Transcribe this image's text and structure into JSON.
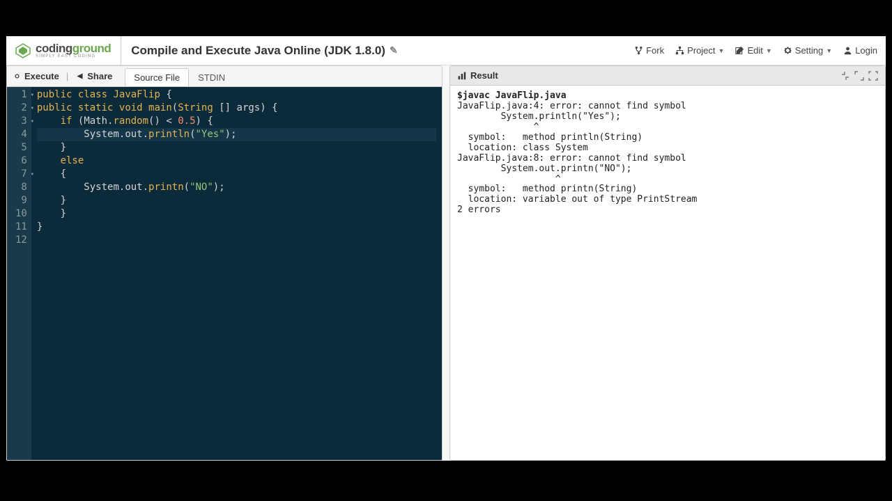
{
  "brand": {
    "name_a": "coding",
    "name_b": "ground",
    "tagline": "SIMPLY EASY CODING"
  },
  "page": {
    "title": "Compile and Execute Java Online (JDK 1.8.0)"
  },
  "menu": {
    "fork": "Fork",
    "project": "Project",
    "edit": "Edit",
    "setting": "Setting",
    "login": "Login"
  },
  "toolbar": {
    "execute": "Execute",
    "share": "Share"
  },
  "tabs": {
    "source": "Source File",
    "stdin": "STDIN"
  },
  "editor": {
    "lines": [
      {
        "n": 1,
        "fold": true,
        "tokens": [
          [
            "kw",
            "public"
          ],
          [
            "sp",
            " "
          ],
          [
            "kw",
            "class"
          ],
          [
            "sp",
            " "
          ],
          [
            "type",
            "JavaFlip"
          ],
          [
            "sp",
            " "
          ],
          [
            "punct",
            "{"
          ]
        ]
      },
      {
        "n": 2,
        "fold": true,
        "tokens": [
          [
            "kw",
            "public"
          ],
          [
            "sp",
            " "
          ],
          [
            "kw",
            "static"
          ],
          [
            "sp",
            " "
          ],
          [
            "kw",
            "void"
          ],
          [
            "sp",
            " "
          ],
          [
            "func",
            "main"
          ],
          [
            "punct",
            "("
          ],
          [
            "type",
            "String"
          ],
          [
            "sp",
            " "
          ],
          [
            "punct",
            "[] "
          ],
          [
            "ident",
            "args"
          ],
          [
            "punct",
            ")"
          ],
          [
            "sp",
            " "
          ],
          [
            "punct",
            "{"
          ]
        ]
      },
      {
        "n": 3,
        "fold": true,
        "tokens": [
          [
            "sp",
            "    "
          ],
          [
            "kw",
            "if"
          ],
          [
            "sp",
            " "
          ],
          [
            "punct",
            "("
          ],
          [
            "ident",
            "Math"
          ],
          [
            "punct",
            "."
          ],
          [
            "func",
            "random"
          ],
          [
            "punct",
            "()"
          ],
          [
            "sp",
            " "
          ],
          [
            "punct",
            "<"
          ],
          [
            "sp",
            " "
          ],
          [
            "num",
            "0.5"
          ],
          [
            "punct",
            ")"
          ],
          [
            "sp",
            " "
          ],
          [
            "punct",
            "{"
          ]
        ]
      },
      {
        "n": 4,
        "hl": true,
        "tokens": [
          [
            "sp",
            "        "
          ],
          [
            "ident",
            "System"
          ],
          [
            "punct",
            "."
          ],
          [
            "ident",
            "out"
          ],
          [
            "punct",
            "."
          ],
          [
            "func",
            "println"
          ],
          [
            "punct",
            "("
          ],
          [
            "str",
            "\"Yes\""
          ],
          [
            "punct",
            ");"
          ]
        ]
      },
      {
        "n": 5,
        "tokens": [
          [
            "sp",
            "    "
          ],
          [
            "punct",
            "}"
          ]
        ]
      },
      {
        "n": 6,
        "tokens": [
          [
            "sp",
            "    "
          ],
          [
            "kw",
            "else"
          ]
        ]
      },
      {
        "n": 7,
        "fold": true,
        "tokens": [
          [
            "sp",
            "    "
          ],
          [
            "punct",
            "{"
          ]
        ]
      },
      {
        "n": 8,
        "tokens": [
          [
            "sp",
            "        "
          ],
          [
            "ident",
            "System"
          ],
          [
            "punct",
            "."
          ],
          [
            "ident",
            "out"
          ],
          [
            "punct",
            "."
          ],
          [
            "func",
            "printn"
          ],
          [
            "punct",
            "("
          ],
          [
            "str",
            "\"NO\""
          ],
          [
            "punct",
            ");"
          ]
        ]
      },
      {
        "n": 9,
        "tokens": [
          [
            "sp",
            "    "
          ],
          [
            "punct",
            "}"
          ]
        ]
      },
      {
        "n": 10,
        "tokens": [
          [
            "sp",
            "    "
          ],
          [
            "punct",
            "}"
          ]
        ]
      },
      {
        "n": 11,
        "tokens": [
          [
            "punct",
            "}"
          ]
        ]
      },
      {
        "n": 12,
        "tokens": []
      }
    ]
  },
  "result": {
    "title": "Result",
    "command": "$javac JavaFlip.java",
    "output": "JavaFlip.java:4: error: cannot find symbol\n        System.println(\"Yes\");\n              ^\n  symbol:   method println(String)\n  location: class System\nJavaFlip.java:8: error: cannot find symbol\n        System.out.printn(\"NO\");\n                  ^\n  symbol:   method printn(String)\n  location: variable out of type PrintStream\n2 errors"
  }
}
